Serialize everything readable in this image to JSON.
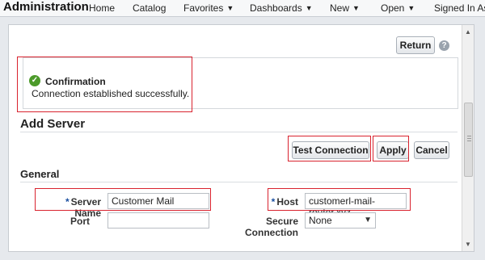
{
  "topbar": {
    "title": "Administration",
    "nav": [
      {
        "label": "Home",
        "dropdown": false
      },
      {
        "label": "Catalog",
        "dropdown": false
      },
      {
        "label": "Favorites",
        "dropdown": true
      },
      {
        "label": "Dashboards",
        "dropdown": true
      },
      {
        "label": "New",
        "dropdown": true
      },
      {
        "label": "Open",
        "dropdown": true
      },
      {
        "label": "Signed In As",
        "dropdown": false
      }
    ]
  },
  "toolbar": {
    "return_label": "Return",
    "help_icon": "question-icon"
  },
  "confirmation": {
    "title": "Confirmation",
    "message": "Connection established successfully.",
    "icon": "check-circle-icon"
  },
  "add_server": {
    "title": "Add Server",
    "test_connection_label": "Test Connection",
    "apply_label": "Apply",
    "cancel_label": "Cancel"
  },
  "general": {
    "title": "General",
    "server_name_label": "Server Name",
    "server_name_value": "Customer Mail",
    "host_label": "Host",
    "host_value": "customerl-mail-router.xyz",
    "port_label": "Port",
    "port_value": "",
    "secure_label": "Secure Connection",
    "secure_value": "None",
    "required_marker": "*"
  },
  "colors": {
    "highlight": "#d9232f",
    "success": "#4c9a2a"
  }
}
